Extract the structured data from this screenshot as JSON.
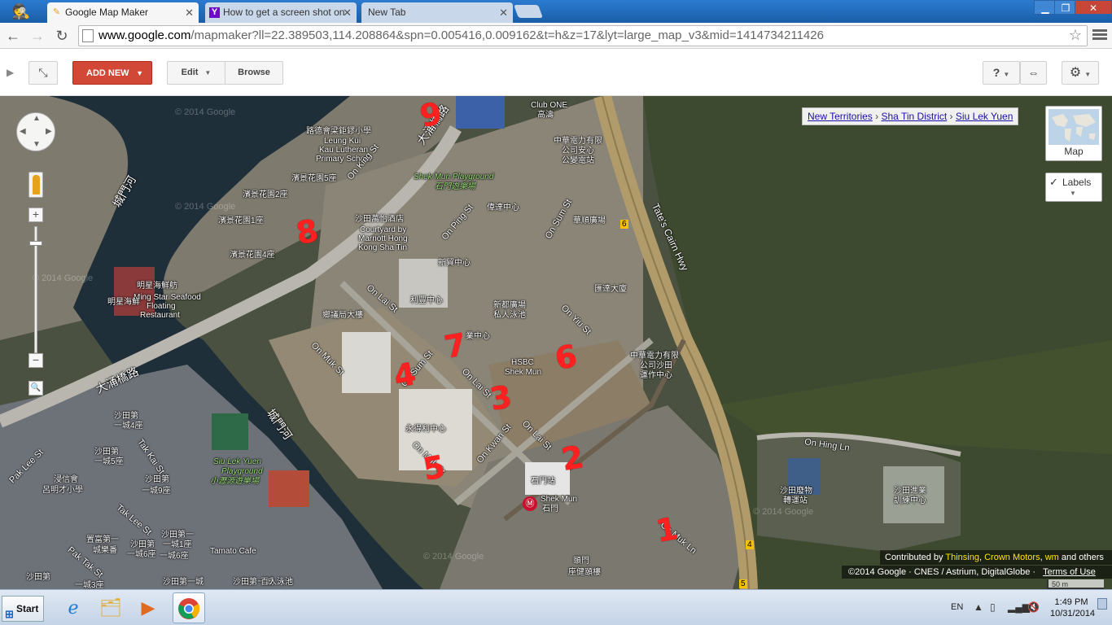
{
  "browser": {
    "tabs": [
      {
        "title": "Google Map Maker",
        "favicon": "pencil-map-icon",
        "active": true
      },
      {
        "title": "How to get a screen shot on",
        "favicon": "yahoo-icon",
        "active": false
      },
      {
        "title": "New Tab",
        "favicon": "",
        "active": false
      }
    ],
    "window_controls": {
      "minimize": "▁",
      "maximize": "❐",
      "close": "✕"
    },
    "address": {
      "host": "www.google.com",
      "path": "/mapmaker?ll=22.389503,114.208864&spn=0.005416,0.009162&t=h&z=17&lyt=large_map_v3&mid=1414734211426"
    }
  },
  "appbar": {
    "add_new_label": "ADD NEW",
    "edit_label": "Edit",
    "browse_label": "Browse",
    "help_label": "?",
    "link_label": "⇔",
    "settings_label": "⚙"
  },
  "map": {
    "breadcrumb": [
      "New Territories",
      "Sha Tin District",
      "Siu Lek Yuen"
    ],
    "breadcrumb_separator": "›",
    "maptype_label": "Map",
    "labels_label": "Labels",
    "contrib": {
      "prefix": "Contributed by",
      "names": [
        "Thinsing",
        "Crown Motors",
        "wm"
      ],
      "suffix": "and others"
    },
    "copyright": "©2014 Google · CNES / Astrium, DigitalGlobe ·",
    "terms": "Terms of Use",
    "scale": "50 m",
    "watermark": "© 2014 Google",
    "labels": {
      "school_cn": "路德會梁鉅鏐小學",
      "school_en1": "Leung Kui",
      "school_en2": "Kau Lutheran",
      "school_en3": "Primary School",
      "clubone_en": "Club ONE",
      "clubone_cn": "高濤",
      "clp_cn1": "中華電力有限",
      "clp_cn2": "公司安心",
      "clp_cn3": "公變電站",
      "playground_en": "Shek Mun Playground",
      "playground_cn": "石門遊樂場",
      "garden5": "濱景花園5座",
      "garden2": "濱景花園2座",
      "garden1": "濱景花園1座",
      "garden4": "濱景花園4座",
      "river_cn": "城門河",
      "marriott_cn": "沙田萬怡酒店",
      "marriott_en1": "Courtyard by",
      "marriott_en2": "Marriott Hong",
      "marriott_en3": "Kong Sha Tin",
      "weida": "偉達中心",
      "waguang": "華順廣場",
      "xinmao": "新貿中心",
      "huida": "匯達大廈",
      "mingxing_cn": "明星海鮮舫",
      "mingxing_en1": "Ming Star Seafood",
      "mingxing_en2": "Floating",
      "mingxing_en3": "Restaurant",
      "mingxing_cn2": "明星海鮮",
      "lifeng": "利豐中心",
      "xindu_cn1": "新都廣場",
      "xindu_cn2": "私人泳池",
      "xiangyi": "鄉議局大樓",
      "yixun": "業中心",
      "hsbc_en1": "HSBC",
      "hsbc_en2": "Shek Mun",
      "clp2_cn1": "中華電力有限",
      "clp2_cn2": "公司沙田",
      "clp2_cn3": "運作中心",
      "yongxin": "永得利中心",
      "shekmun_cn_sign": "石門站",
      "shekmun_en": "Shek Mun",
      "shekmun_cn": "石門",
      "shatin_transfer1": "沙田廢物",
      "shatin_transfer2": "轉運站",
      "shatin_train1": "沙田進業",
      "shatin_train2": "訓練中心",
      "siulekyuen_en1": "Siu Lek Yuen",
      "siulekyuen_en2": "Playground",
      "siulekyuen_cn": "小瀝源遊樂場",
      "tamato": "Tamato Cafe",
      "zuntuo": "頤門",
      "zuntuo2": "座健頤樓",
      "st1": "沙田第",
      "st2": "一城4座",
      "st3": "沙田第",
      "st4": "一城5座",
      "st5": "浸信會",
      "st6": "呂明才小學",
      "st7": "沙田第",
      "st8": "一城9座",
      "st9": "沙田第一",
      "st10": "一城1座",
      "st11": "置富第一",
      "st12": "城樂番",
      "st13": "一城6座",
      "st14": "沙田第",
      "st15": "一城6座",
      "st16": "沙田第",
      "st17": "沙田第一城",
      "st18": "一城3座",
      "st19": "沙田第一城",
      "st20": "百人泳池",
      "road_taichung": "大涌橋路",
      "road_onking": "On King St",
      "road_onping": "On Ping St",
      "road_onsum": "On Sum St",
      "road_tates": "Tate's Cairn Hwy",
      "road_onlai1": "On Lai St",
      "road_onmuk1": "On Muk St",
      "road_onyiu": "On Yiu St",
      "road_onlai2": "On Lai St",
      "road_onlai3": "On Lai St",
      "road_onsum2": "On Sum St",
      "road_onkwan": "On Kwan St",
      "road_onmuk2": "On Muk St",
      "road_onhing": "On Hing Ln",
      "road_taichung2": "大涌橋路",
      "road_pakleest": "Pak Lee St",
      "road_takkaist": "Tak Kai St",
      "road_takleest": "Tak Lee St",
      "road_paktakst": "Pak Tak St",
      "road_onmukln": "On Muk Ln",
      "road_chengmen2": "城門河",
      "road_hwy6": "6",
      "road_hwy4": "4",
      "road_hwy5": "5"
    },
    "annotations": [
      "1",
      "2",
      "3",
      "4",
      "5",
      "6",
      "7",
      "8",
      "9"
    ]
  },
  "taskbar": {
    "start_label": "Start",
    "language": "EN",
    "time": "1:49 PM",
    "date": "10/31/2014"
  }
}
